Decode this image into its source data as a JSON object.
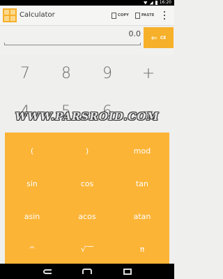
{
  "status_bar": {
    "time": "16:20"
  },
  "action_bar": {
    "title": "Calculator",
    "copy_label": "COPY",
    "paste_label": "PASTE",
    "icons": {
      "app": "calculator-app-icon",
      "copy": "copy-icon",
      "paste": "paste-icon",
      "overflow": "overflow-menu-icon"
    }
  },
  "display": {
    "value": "0.0",
    "ce_label": "CE",
    "ce_icon": "backspace-arrow-icon"
  },
  "numpad": {
    "row1": [
      "7",
      "8",
      "9",
      "+"
    ],
    "row2": [
      "4",
      "5",
      "6",
      "−"
    ]
  },
  "watermark": "WWW.PARSROID.COM",
  "scientific_panel": {
    "rows": [
      [
        "(",
        ")",
        "mod"
      ],
      [
        "sin",
        "cos",
        "tan"
      ],
      [
        "asin",
        "acos",
        "atan"
      ],
      [
        "^",
        "√‾‾",
        "π"
      ]
    ]
  },
  "nav_bar": {
    "icons": [
      "back-icon",
      "home-icon",
      "recents-icon"
    ]
  },
  "colors": {
    "accent": "#f6b02a",
    "panel": "#fcb437",
    "background": "#efefee"
  }
}
